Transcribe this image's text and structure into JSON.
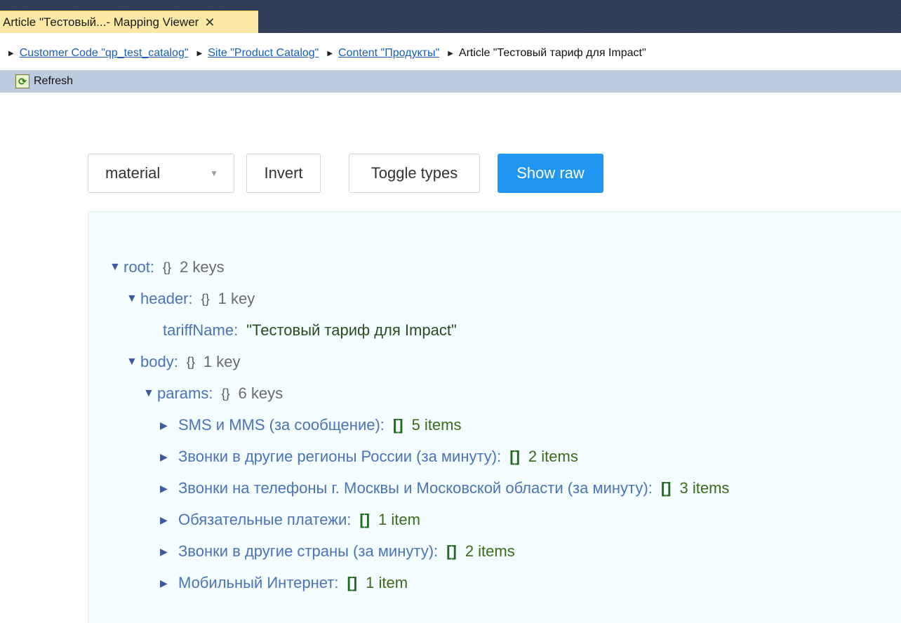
{
  "window": {
    "tab_title": "Article \"Тестовый...- Mapping Viewer",
    "tab_close": "✕"
  },
  "breadcrumb": {
    "items": [
      {
        "label": "Customer Code \"qp_test_catalog\"",
        "link": true
      },
      {
        "label": "Site \"Product Catalog\"",
        "link": true
      },
      {
        "label": "Content \"Продукты\"",
        "link": true
      },
      {
        "label": "Article \"Тестовый тариф для Impact\"",
        "link": false
      }
    ]
  },
  "toolbar": {
    "refresh_label": "Refresh"
  },
  "controls": {
    "theme_value": "material",
    "invert_label": "Invert",
    "toggle_types_label": "Toggle types",
    "show_raw_label": "Show raw"
  },
  "tree": {
    "root": {
      "key": "root",
      "braces": "{}",
      "count": "2 keys"
    },
    "header": {
      "key": "header",
      "braces": "{}",
      "count": "1 key"
    },
    "tariffName": {
      "key": "tariffName",
      "value": "\"Тестовый тариф для Impact\""
    },
    "body": {
      "key": "body",
      "braces": "{}",
      "count": "1 key"
    },
    "params": {
      "key": "params",
      "braces": "{}",
      "count": "6 keys"
    },
    "params_items": [
      {
        "key": "SMS и MMS (за сообщение)",
        "brackets": "[]",
        "count": "5 items"
      },
      {
        "key": "Звонки в другие регионы России (за минуту)",
        "brackets": "[]",
        "count": "2 items"
      },
      {
        "key": "Звонки на телефоны г. Москвы и Московской области (за минуту)",
        "brackets": "[]",
        "count": "3 items"
      },
      {
        "key": "Обязательные платежи",
        "brackets": "[]",
        "count": "1 item"
      },
      {
        "key": "Звонки в другие страны (за минуту)",
        "brackets": "[]",
        "count": "2 items"
      },
      {
        "key": "Мобильный Интернет",
        "brackets": "[]",
        "count": "1 item"
      }
    ]
  },
  "colors": {
    "accent": "#2196f3",
    "tab_bg": "#fde9a5",
    "toolbar_bg": "#bccbdd",
    "panel_bg": "#f4fdff"
  }
}
